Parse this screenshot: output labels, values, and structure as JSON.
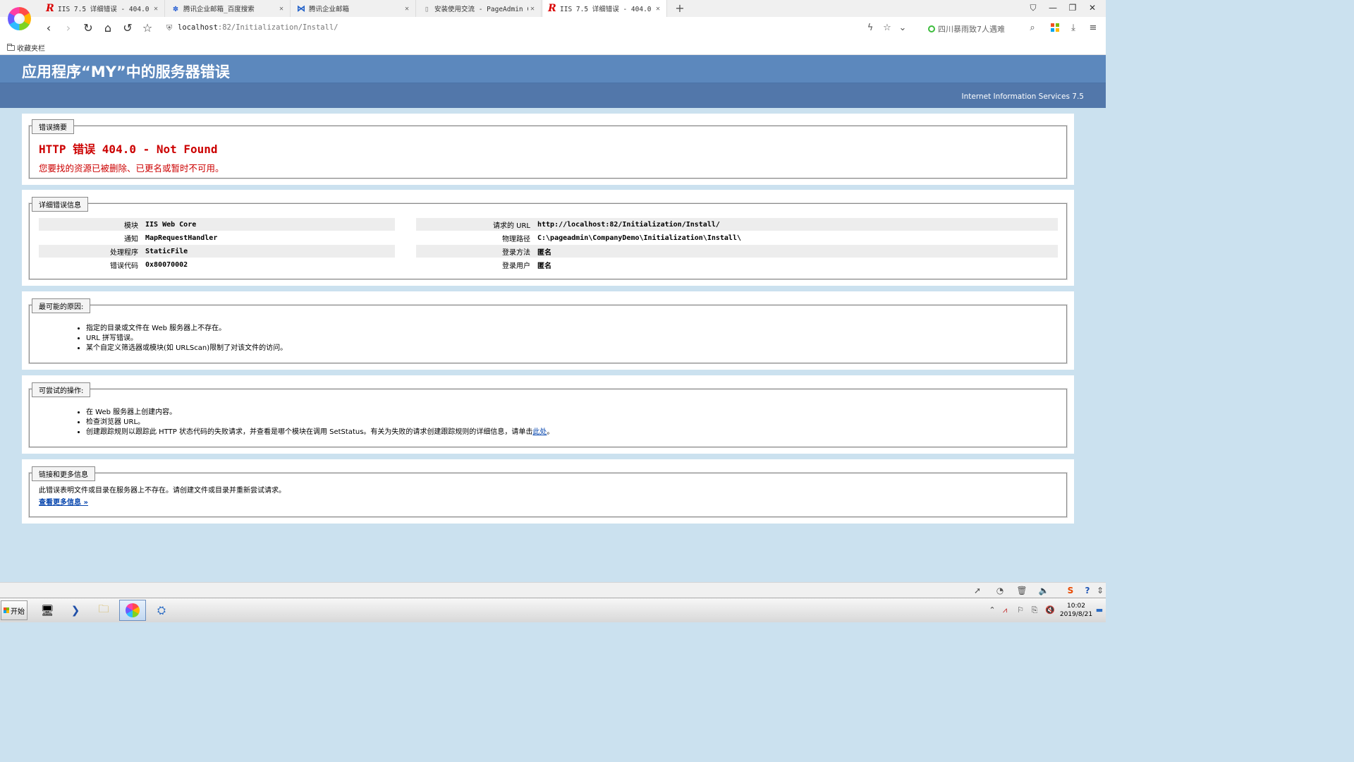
{
  "browser": {
    "tabs": [
      {
        "favicon": "iis-r-icon",
        "title": "IIS 7.5 详细错误 - 404.0 -",
        "active": false
      },
      {
        "favicon": "baidu-paw-icon",
        "title": "腾讯企业邮箱_百度搜索",
        "active": false
      },
      {
        "favicon": "tencent-mail-icon",
        "title": "腾讯企业邮箱",
        "active": false
      },
      {
        "favicon": "document-icon",
        "title": "安装使用交流 - PageAdmin CM",
        "active": false
      },
      {
        "favicon": "iis-r-icon",
        "title": "IIS 7.5 详细错误 - 404.0 -",
        "active": true
      }
    ],
    "url_host": "localhost",
    "url_rest": ":82/Initialization/Install/",
    "search_suggestion": "四川暴雨致7人遇难",
    "bookmarks_label": "收藏夹栏"
  },
  "page": {
    "header_title": "应用程序“MY”中的服务器错误",
    "server_name": "Internet Information Services 7.5",
    "summary": {
      "legend": "错误摘要",
      "title": "HTTP 错误 404.0 - Not Found",
      "description": "您要找的资源已被删除、已更名或暂时不可用。"
    },
    "details": {
      "legend": "详细错误信息",
      "left": [
        {
          "label": "模块",
          "value": "IIS Web Core"
        },
        {
          "label": "通知",
          "value": "MapRequestHandler"
        },
        {
          "label": "处理程序",
          "value": "StaticFile"
        },
        {
          "label": "错误代码",
          "value": "0x80070002"
        }
      ],
      "right": [
        {
          "label": "请求的 URL",
          "value": "http://localhost:82/Initialization/Install/"
        },
        {
          "label": "物理路径",
          "value": "C:\\pageadmin\\CompanyDemo\\Initialization\\Install\\"
        },
        {
          "label": "登录方法",
          "value": "匿名"
        },
        {
          "label": "登录用户",
          "value": "匿名"
        }
      ]
    },
    "causes": {
      "legend": "最可能的原因:",
      "items": [
        "指定的目录或文件在 Web 服务器上不存在。",
        "URL 拼写错误。",
        "某个自定义筛选器或模块(如 URLScan)限制了对该文件的访问。"
      ]
    },
    "actions": {
      "legend": "可尝试的操作:",
      "items": [
        "在 Web 服务器上创建内容。",
        "检查浏览器 URL。"
      ],
      "item3_text": "创建跟踪规则以跟踪此 HTTP 状态代码的失败请求，并查看是哪个模块在调用 SetStatus。有关为失败的请求创建跟踪规则的详细信息，请单击",
      "item3_link": "此处",
      "item3_end": "。"
    },
    "more": {
      "legend": "链接和更多信息",
      "text": "此错误表明文件或目录在服务器上不存在。请创建文件或目录并重新尝试请求。",
      "link": "查看更多信息 »"
    }
  },
  "taskbar": {
    "start_label": "开始",
    "time": "10:02",
    "date": "2019/8/21"
  }
}
